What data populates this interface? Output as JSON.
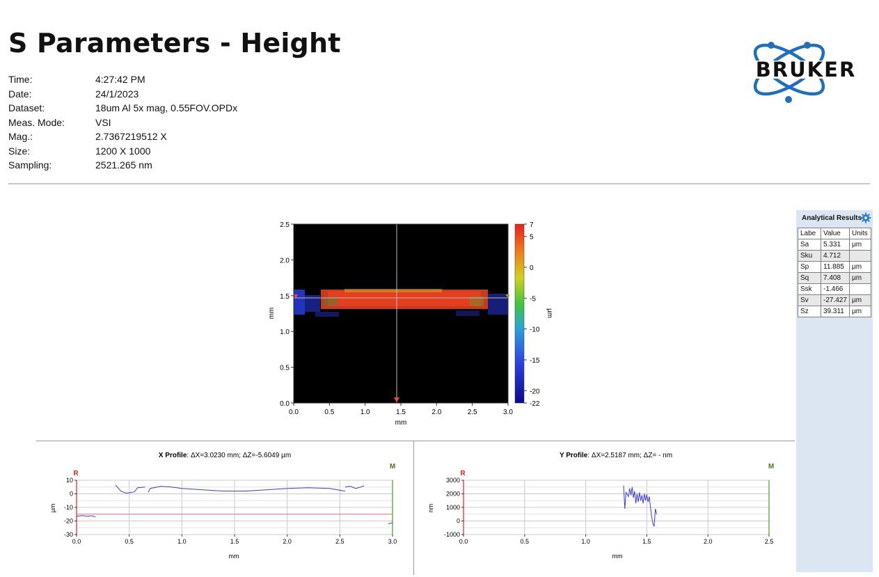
{
  "header": {
    "title": "S Parameters - Height",
    "meta": [
      {
        "key": "Time:",
        "value": "4:27:42 PM"
      },
      {
        "key": "Date:",
        "value": "24/1/2023"
      },
      {
        "key": "Dataset:",
        "value": "18um Al 5x mag, 0.55FOV.OPDx"
      },
      {
        "key": "Meas. Mode:",
        "value": "VSI"
      },
      {
        "key": "Mag.:",
        "value": "2.7367219512 X"
      },
      {
        "key": "Size:",
        "value": "1200 X 1000"
      },
      {
        "key": "Sampling:",
        "value": "2521.265 nm"
      }
    ]
  },
  "logo": {
    "text": "BRUKER",
    "color": "#1f6fc1"
  },
  "analytical": {
    "title": "Analytical Results",
    "headers": [
      "Labe",
      "Value",
      "Units"
    ],
    "rows": [
      [
        "Sa",
        "5.331",
        "µm"
      ],
      [
        "Sku",
        "4.712",
        ""
      ],
      [
        "Sp",
        "11.885",
        "µm"
      ],
      [
        "Sq",
        "7.408",
        "µm"
      ],
      [
        "Ssk",
        "-1.466",
        ""
      ],
      [
        "Sv",
        "-27.427",
        "µm"
      ],
      [
        "Sz",
        "39.311",
        "µm"
      ]
    ]
  },
  "chart_data": [
    {
      "type": "heatmap",
      "xlabel": "mm",
      "ylabel": "mm",
      "xlim": [
        0,
        3.0
      ],
      "ylim": [
        0,
        2.5
      ],
      "xticks": [
        "0.0",
        "0.5",
        "1.0",
        "1.5",
        "2.0",
        "2.5",
        "3.0"
      ],
      "yticks": [
        "0.0",
        "0.5",
        "1.0",
        "1.5",
        "2.0",
        "2.5"
      ],
      "colorbar": {
        "label": "µm",
        "min": -22,
        "max": 7,
        "ticks": [
          "7",
          "5",
          "0",
          "-5",
          "-10",
          "-15",
          "-20",
          "-22"
        ]
      },
      "cursor": {
        "x": 1.45,
        "y": 1.48
      },
      "colors": {
        "high": "#e6261f",
        "mid": "#3ec43e",
        "low": "#1f2ed0",
        "background": "#000000"
      }
    },
    {
      "type": "line",
      "title_bold": "X Profile",
      "title_rest": ": ΔX=3.0230 mm; ΔZ=-5.6049 µm",
      "xlabel": "mm",
      "ylabel": "µm",
      "xlim": [
        0,
        3.0
      ],
      "ylim": [
        -30,
        10
      ],
      "xticks": [
        "0.0",
        "0.5",
        "1.0",
        "1.5",
        "2.0",
        "2.5",
        "3.0"
      ],
      "yticks": [
        "10",
        "0",
        "-10",
        "-20",
        "-30"
      ],
      "marker_r": "R",
      "marker_m": "M",
      "reference_line": {
        "y": -15,
        "color": "#e05050"
      },
      "series": [
        {
          "points": [
            [
              0.0,
              -16.5
            ],
            [
              0.05,
              -16
            ],
            [
              0.1,
              -16.5
            ],
            [
              0.15,
              -16.2
            ],
            [
              0.18,
              -17
            ]
          ]
        },
        {
          "points": [
            [
              0.37,
              6.5
            ],
            [
              0.42,
              2
            ],
            [
              0.47,
              0.5
            ],
            [
              0.52,
              1
            ],
            [
              0.55,
              1.5
            ],
            [
              0.58,
              4.5
            ],
            [
              0.65,
              5
            ]
          ]
        },
        {
          "points": [
            [
              0.68,
              1
            ],
            [
              0.7,
              4
            ],
            [
              0.8,
              5.5
            ],
            [
              0.9,
              5
            ],
            [
              1.0,
              4
            ],
            [
              1.2,
              3
            ],
            [
              1.4,
              2
            ],
            [
              1.6,
              2
            ],
            [
              1.8,
              3
            ],
            [
              2.0,
              4
            ],
            [
              2.2,
              4.5
            ],
            [
              2.4,
              4
            ],
            [
              2.55,
              2
            ]
          ]
        },
        {
          "points": [
            [
              2.55,
              5
            ],
            [
              2.6,
              5.5
            ],
            [
              2.65,
              4
            ],
            [
              2.7,
              5
            ],
            [
              2.73,
              6
            ]
          ]
        },
        {
          "points": [
            [
              2.96,
              -22
            ],
            [
              3.0,
              -21.5
            ]
          ]
        }
      ]
    },
    {
      "type": "line",
      "title_bold": "Y Profile",
      "title_rest": ": ΔX=2.5187 mm; ΔZ= -  nm",
      "xlabel": "mm",
      "ylabel": "nm",
      "xlim": [
        0,
        2.5
      ],
      "ylim": [
        -1000,
        3000
      ],
      "xticks": [
        "0.0",
        "0.5",
        "1.0",
        "1.5",
        "2.0",
        "2.5"
      ],
      "yticks": [
        "3000",
        "2000",
        "1000",
        "0",
        "-1000"
      ],
      "marker_r": "R",
      "marker_m": "M",
      "series": [
        {
          "points": [
            [
              1.31,
              2600
            ],
            [
              1.32,
              900
            ],
            [
              1.33,
              2100
            ],
            [
              1.35,
              1800
            ],
            [
              1.36,
              2400
            ],
            [
              1.37,
              1900
            ],
            [
              1.38,
              2500
            ],
            [
              1.39,
              1700
            ],
            [
              1.4,
              2200
            ],
            [
              1.41,
              1300
            ],
            [
              1.42,
              2000
            ],
            [
              1.43,
              1400
            ],
            [
              1.44,
              2100
            ],
            [
              1.45,
              1500
            ],
            [
              1.46,
              1900
            ],
            [
              1.47,
              1300
            ],
            [
              1.48,
              2000
            ],
            [
              1.49,
              1500
            ],
            [
              1.5,
              1950
            ],
            [
              1.51,
              1400
            ],
            [
              1.52,
              1800
            ],
            [
              1.53,
              1000
            ],
            [
              1.54,
              300
            ],
            [
              1.55,
              -200
            ],
            [
              1.56,
              -400
            ],
            [
              1.57,
              900
            ],
            [
              1.58,
              500
            ]
          ]
        }
      ]
    }
  ]
}
